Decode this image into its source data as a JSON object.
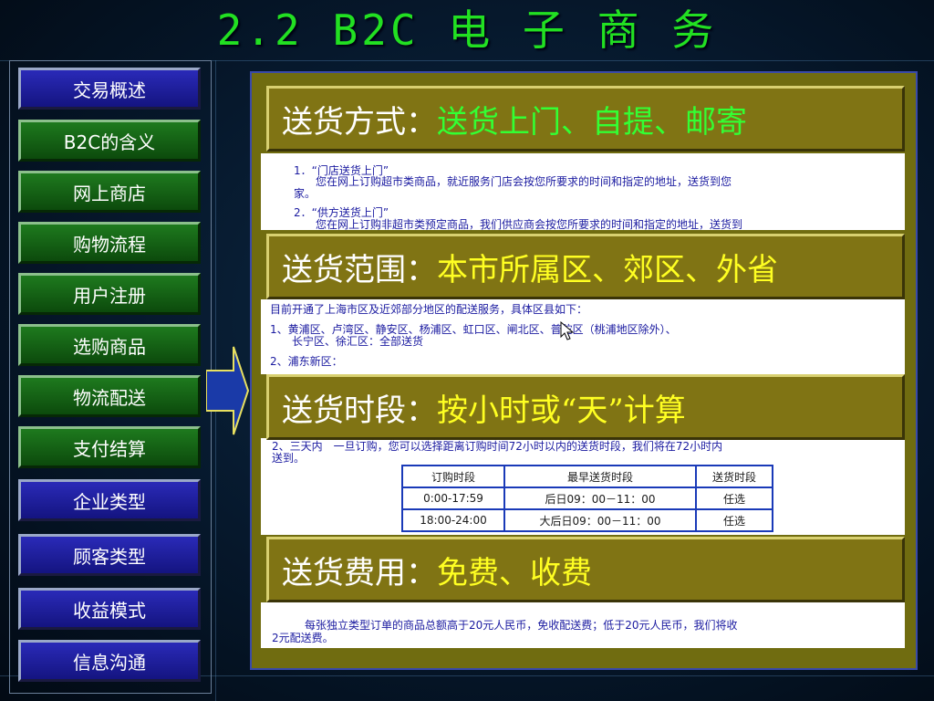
{
  "title": "2.2 B2C 电 子 商 务",
  "sidebar": {
    "items": [
      {
        "label": "交易概述",
        "style": "blue"
      },
      {
        "label": "B2C的含义",
        "style": "green"
      },
      {
        "label": "网上商店",
        "style": "green"
      },
      {
        "label": "购物流程",
        "style": "green"
      },
      {
        "label": "用户注册",
        "style": "green"
      },
      {
        "label": "选购商品",
        "style": "green"
      },
      {
        "label": "物流配送",
        "style": "green"
      },
      {
        "label": "支付结算",
        "style": "green"
      },
      {
        "label": "企业类型",
        "style": "blue"
      },
      {
        "label": "顾客类型",
        "style": "blue"
      },
      {
        "label": "收益模式",
        "style": "blue"
      },
      {
        "label": "信息沟通",
        "style": "blue"
      }
    ]
  },
  "sections": [
    {
      "label": "送货方式：",
      "value": "送货上门、自提、邮寄",
      "value_color": "green",
      "panel_lines": [
        "1．“门店送货上门”",
        "　　您在网上订购超市类商品，就近服务门店会按您所要求的时间和指定的地址，送货到您",
        "家。",
        "2．“供方送货上门”",
        "　　您在网上订购非超市类预定商品，我们供应商会按您所要求的时间和指定的地址，送货到"
      ]
    },
    {
      "label": "送货范围：",
      "value": "本市所属区、郊区、外省",
      "value_color": "yellow",
      "panel_lines": [
        "目前开通了上海市区及近郊部分地区的配送服务，具体区县如下：",
        "1、黄浦区、卢湾区、静安区、杨浦区、虹口区、闸北区、普陀区（桃浦地区除外）、",
        "　　长宁区、徐汇区：全部送货",
        "2、浦东新区："
      ]
    },
    {
      "label": "送货时段：",
      "value": "按小时或“天”计算",
      "value_color": "yellow",
      "panel_lines": [
        "2、三天内　一旦订购，您可以选择距离订购时间72小时以内的送货时段，我们将在72小时内",
        "送到。"
      ],
      "table": {
        "headers": [
          "订购时段",
          "最早送货时段",
          "送货时段"
        ],
        "rows": [
          [
            "0:00-17:59",
            "后日09：00－11：00",
            "任选"
          ],
          [
            "18:00-24:00",
            "大后日09：00－11：00",
            "任选"
          ]
        ]
      }
    },
    {
      "label": "送货费用：",
      "value": "免费、收费",
      "value_color": "yellow",
      "panel_lines": [
        "　　　每张独立类型订单的商品总额高于20元人民币，免收配送费；低于20元人民币，我们将收",
        "2元配送费。"
      ]
    }
  ],
  "colors": {
    "title": "#22e022",
    "nav_blue": "#2a2ab8",
    "nav_green": "#1e7a1e",
    "banner": "#807414",
    "value_green": "#33ff33",
    "value_yellow": "#ffff22"
  },
  "icons": [
    "right-arrow-icon",
    "mouse-cursor-icon"
  ]
}
